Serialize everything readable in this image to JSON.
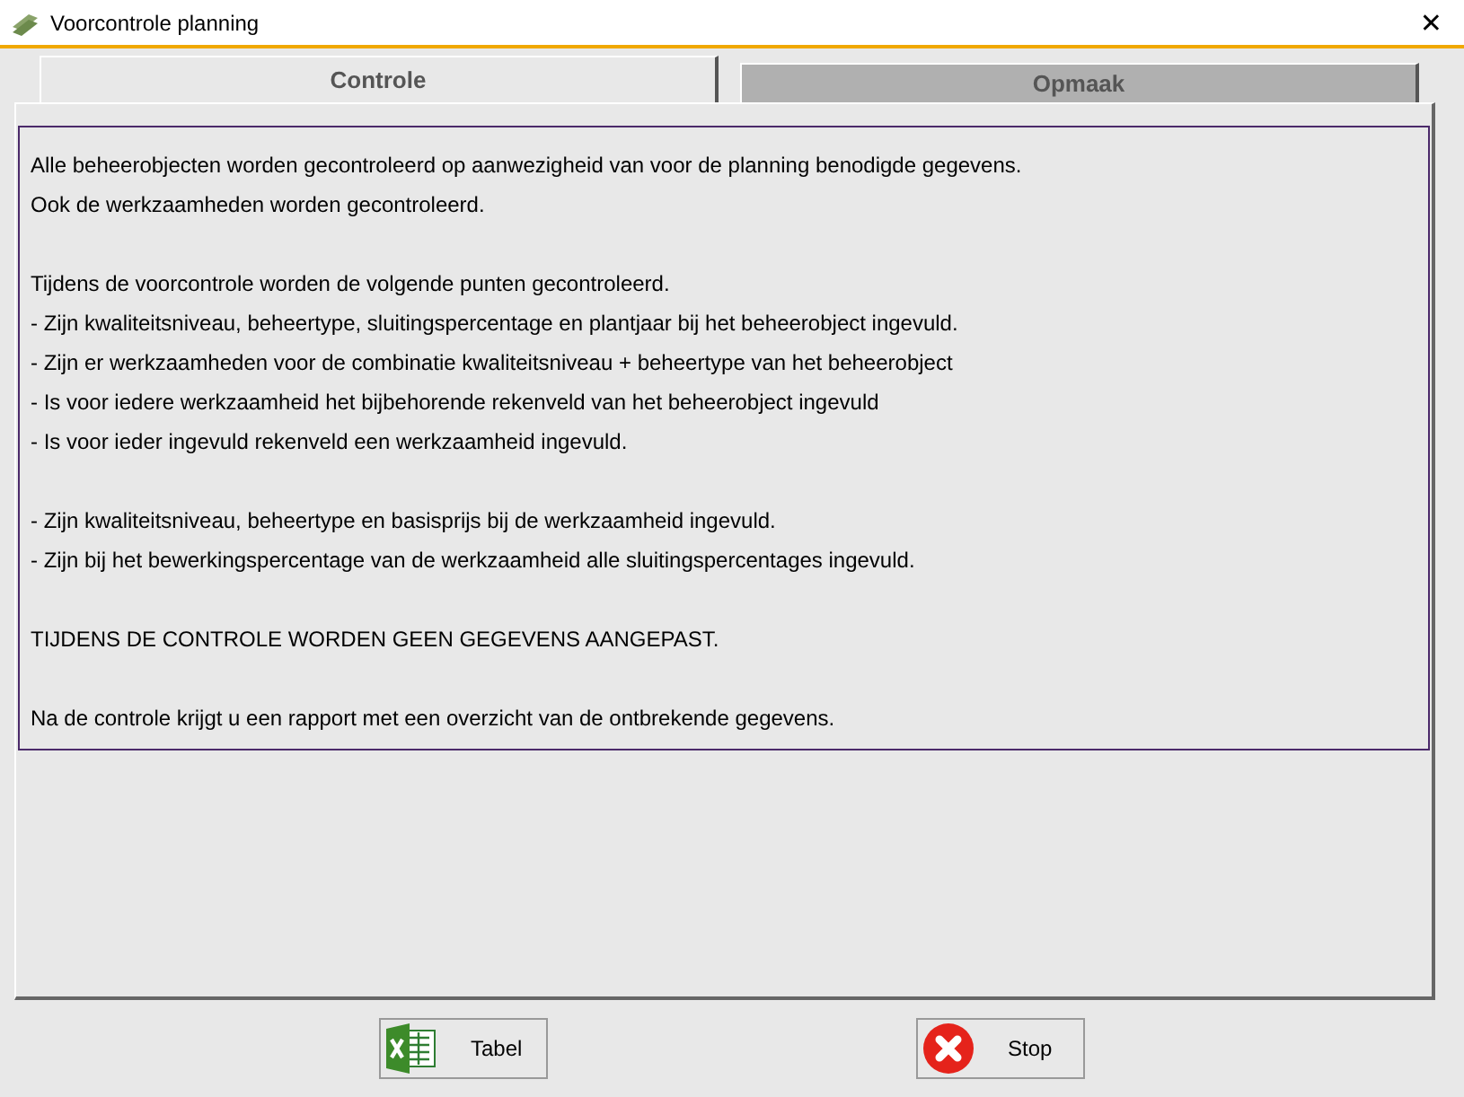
{
  "window": {
    "title": "Voorcontrole planning",
    "close": "✕"
  },
  "tabs": [
    {
      "label": "Controle",
      "selected": true
    },
    {
      "label": "Opmaak",
      "selected": false
    }
  ],
  "paragraphs": [
    [
      "Alle beheerobjecten worden gecontroleerd op aanwezigheid van voor de planning benodigde gegevens.",
      "Ook de werkzaamheden worden gecontroleerd."
    ],
    [
      "Tijdens de voorcontrole worden de volgende punten gecontroleerd.",
      "- Zijn kwaliteitsniveau, beheertype, sluitingspercentage en plantjaar bij het beheerobject ingevuld.",
      "- Zijn er werkzaamheden voor de combinatie kwaliteitsniveau + beheertype van het beheerobject",
      "- Is voor iedere werkzaamheid het bijbehorende rekenveld van het beheerobject ingevuld",
      "- Is voor ieder ingevuld rekenveld een werkzaamheid ingevuld."
    ],
    [
      "- Zijn kwaliteitsniveau, beheertype en basisprijs bij de werkzaamheid ingevuld.",
      "- Zijn bij het bewerkingspercentage van de werkzaamheid alle sluitingspercentages ingevuld."
    ],
    [
      "TIJDENS DE CONTROLE WORDEN GEEN GEGEVENS AANGEPAST."
    ],
    [
      "Na de controle krijgt u een rapport met een overzicht van de ontbrekende gegevens."
    ]
  ],
  "buttons": [
    {
      "label": "Tabel",
      "kind": "spreadsheet"
    },
    {
      "label": "Stop",
      "kind": "stop"
    }
  ]
}
